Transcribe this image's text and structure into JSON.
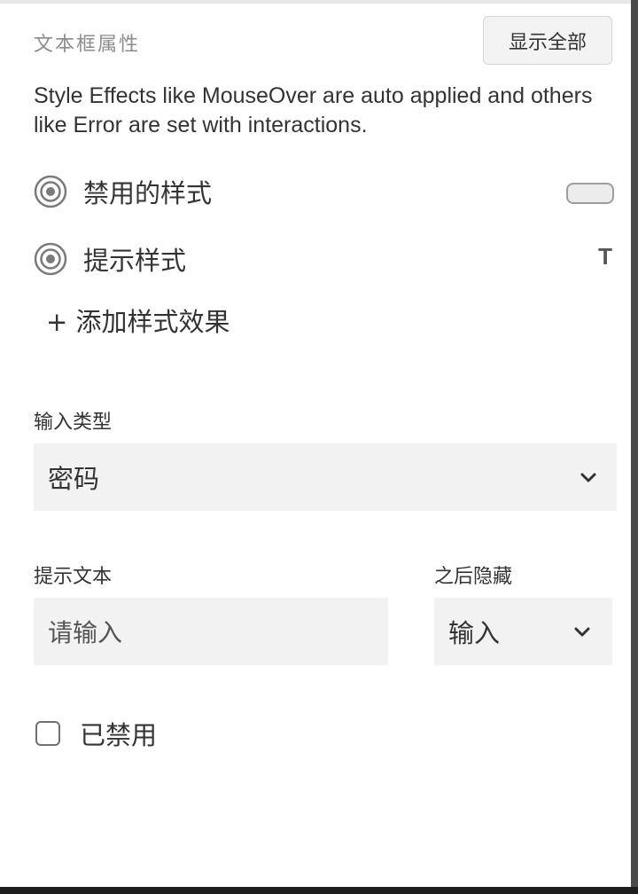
{
  "panel": {
    "title": "文本框属性",
    "show_all_label": "显示全部",
    "description": "Style Effects like MouseOver are auto applied and others like Error are set with interactions."
  },
  "style_effects": [
    {
      "label": "禁用的样式",
      "icon": "radio-target-icon",
      "preview": "rounded-rect"
    },
    {
      "label": "提示样式",
      "icon": "radio-target-icon",
      "preview": "T"
    }
  ],
  "add_effect_label": "+ 添加样式效果",
  "input_type": {
    "label": "输入类型",
    "value": "密码",
    "icon": "chevron-down-icon"
  },
  "hint_text": {
    "label": "提示文本",
    "value": "请输入"
  },
  "hide_after": {
    "label": "之后隐藏",
    "value": "输入",
    "icon": "chevron-down-icon"
  },
  "disabled": {
    "label": "已禁用",
    "checked": false
  },
  "colors": {
    "field_background": "#f2f2f2",
    "title_gray": "#8c8c8c",
    "text": "#333333"
  }
}
